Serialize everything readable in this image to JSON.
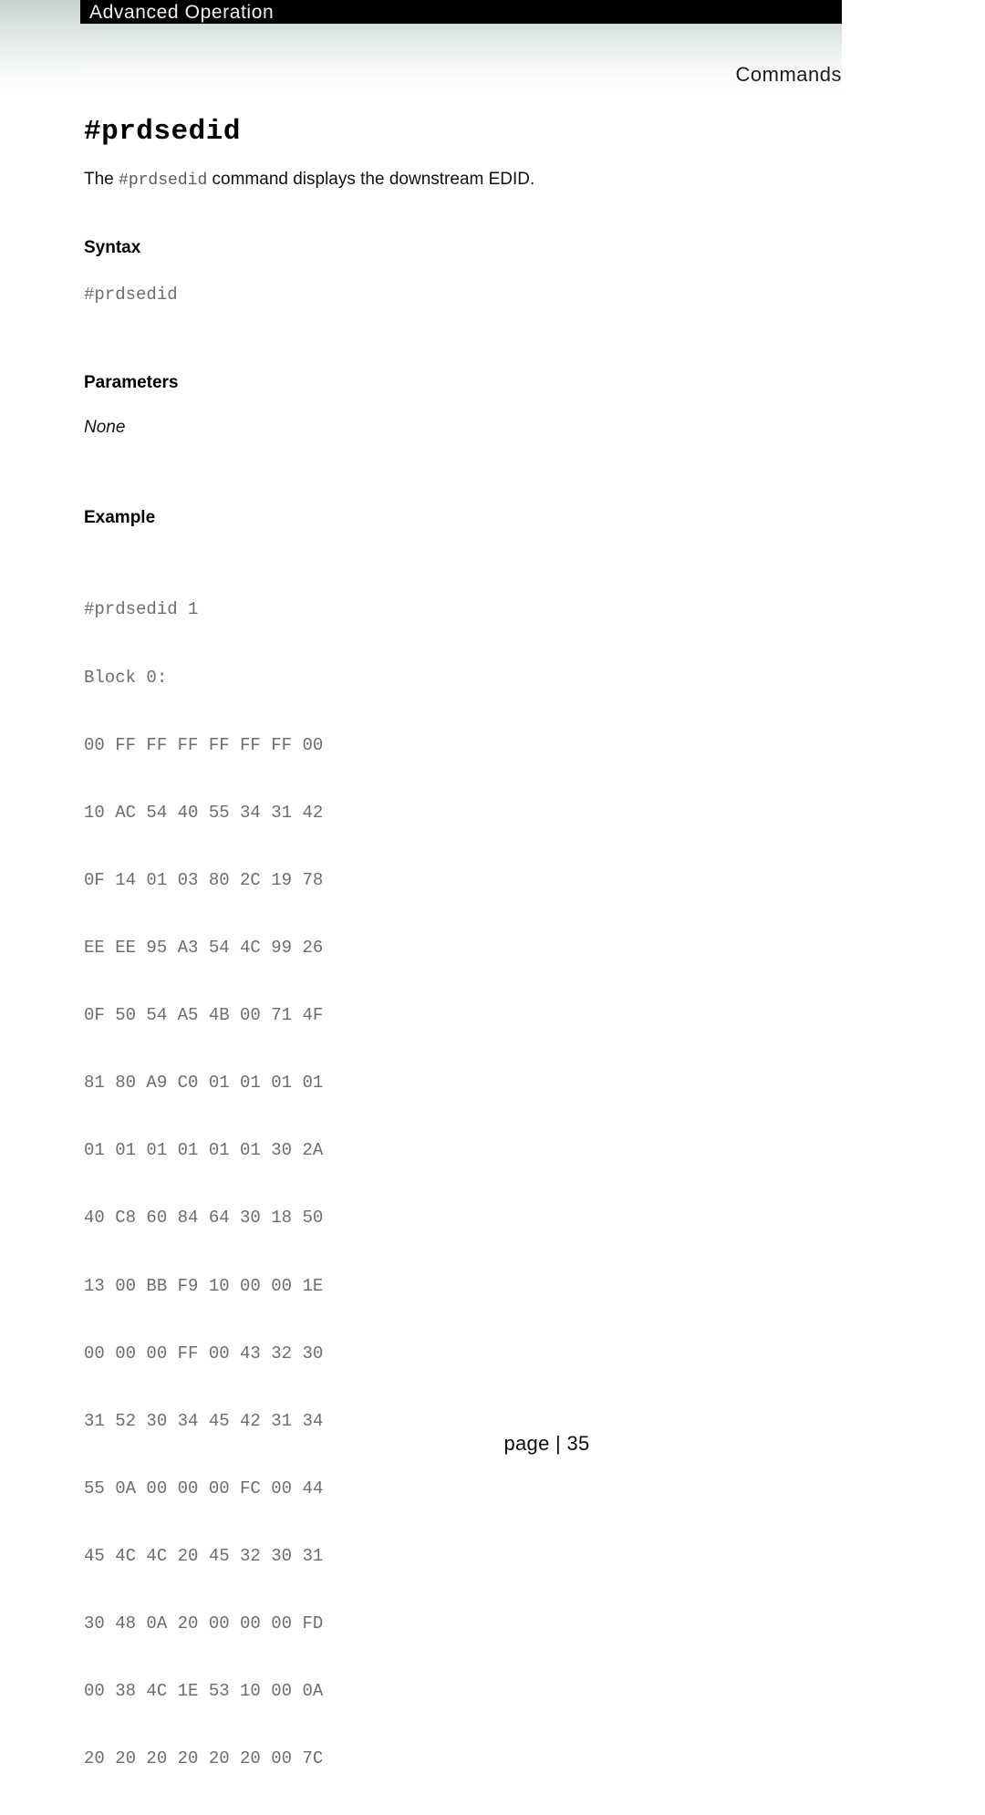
{
  "header": {
    "chapter": "Advanced Operation",
    "section": "Commands"
  },
  "command": {
    "title": "#prdsedid",
    "description_prefix": "The ",
    "description_code": "#prdsedid",
    "description_suffix": " command displays the downstream EDID."
  },
  "sections": {
    "syntax_heading": "Syntax",
    "syntax_code": "#prdsedid",
    "parameters_heading": "Parameters",
    "parameters_value": "None",
    "example_heading": "Example"
  },
  "example": {
    "command_line": "#prdsedid 1",
    "block_label": "Block 0:",
    "hex_lines": [
      "00 FF FF FF FF FF FF 00",
      "10 AC 54 40 55 34 31 42",
      "0F 14 01 03 80 2C 19 78",
      "EE EE 95 A3 54 4C 99 26",
      "0F 50 54 A5 4B 00 71 4F",
      "81 80 A9 C0 01 01 01 01",
      "01 01 01 01 01 01 30 2A",
      "40 C8 60 84 64 30 18 50",
      "13 00 BB F9 10 00 00 1E",
      "00 00 00 FF 00 43 32 30",
      "31 52 30 34 45 42 31 34",
      "55 0A 00 00 00 FC 00 44",
      "45 4C 4C 20 45 32 30 31",
      "30 48 0A 20 00 00 00 FD",
      "00 38 4C 1E 53 10 00 0A",
      "20 20 20 20 20 20 00 7C"
    ]
  },
  "footer": {
    "page_label": "page | 35"
  }
}
